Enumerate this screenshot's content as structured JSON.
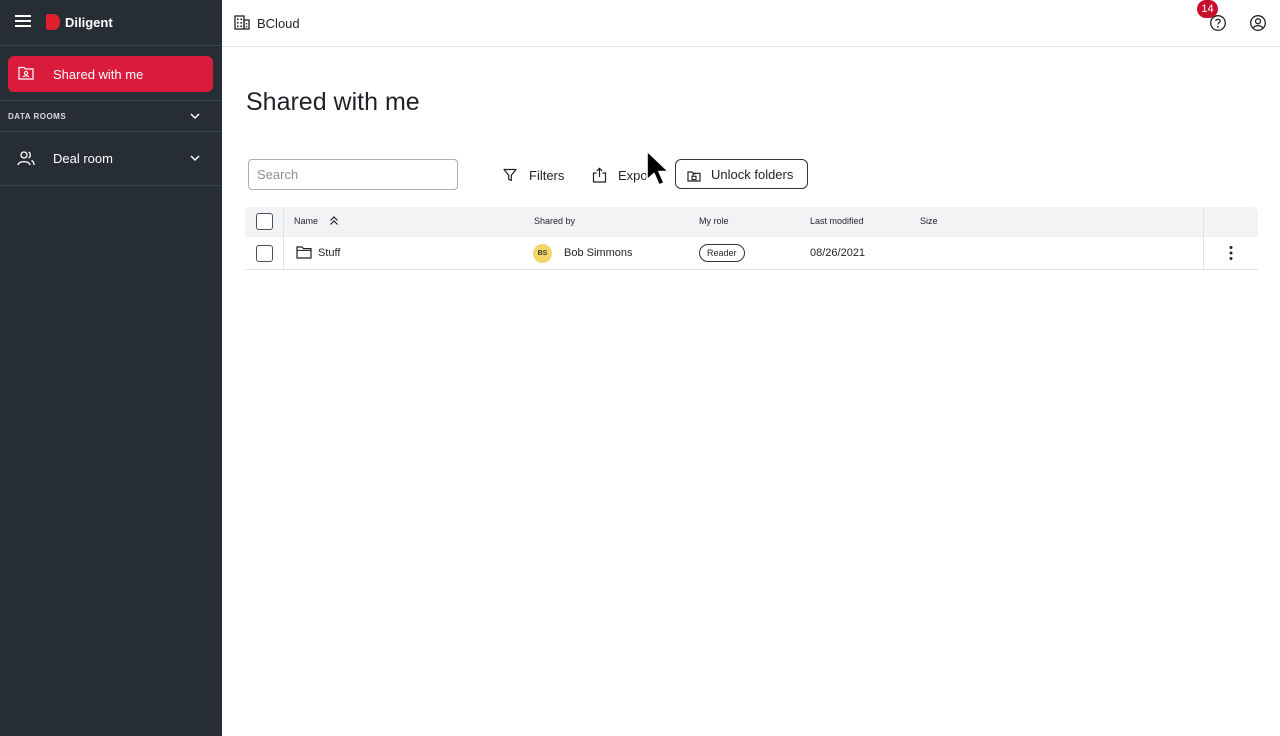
{
  "app": {
    "brand": "Diligent"
  },
  "sidebar": {
    "primary_item": "Shared with me",
    "section_label": "DATA ROOMS",
    "items": [
      {
        "label": "Deal room"
      }
    ]
  },
  "topbar": {
    "breadcrumb": "BCloud",
    "notification_count": "14"
  },
  "main": {
    "title": "Shared with me",
    "search": {
      "placeholder": "Search",
      "value": ""
    },
    "toolbar": {
      "filters_label": "Filters",
      "export_label": "Expo",
      "unlock_label": "Unlock folders"
    }
  },
  "table": {
    "columns": [
      "Name",
      "Shared by",
      "My role",
      "Last modified",
      "Size"
    ],
    "rows": [
      {
        "name": "Stuff",
        "shared_by_initials": "BS",
        "shared_by": "Bob Simmons",
        "role": "Reader",
        "last_modified": "08/26/2021",
        "size": ""
      }
    ]
  },
  "colors": {
    "sidebar_bg": "#262d34",
    "accent": "#d91c3b",
    "badge": "#c8102e",
    "avatar": "#f3d56a"
  },
  "icons": [
    "menu-icon",
    "diligent-logo-icon",
    "shared-folder-icon",
    "chevron-down-icon",
    "people-icon",
    "building-icon",
    "help-icon",
    "account-icon",
    "filter-icon",
    "export-icon",
    "unlock-icon",
    "sort-ascending-icon",
    "folder-icon",
    "more-vertical-icon"
  ]
}
